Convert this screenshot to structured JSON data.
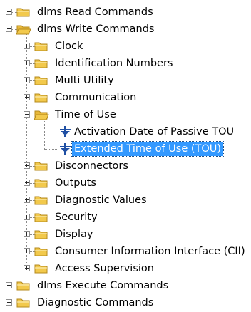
{
  "tree": {
    "items": [
      {
        "label": "dlms Read Commands",
        "level": 0,
        "expander": "plus",
        "icon": "folder-icon",
        "selected": false
      },
      {
        "label": "dlms Write Commands",
        "level": 0,
        "expander": "minus",
        "icon": "folder-open-icon",
        "selected": false
      },
      {
        "label": "Clock",
        "level": 1,
        "expander": "plus",
        "icon": "folder-icon",
        "selected": false
      },
      {
        "label": "Identification Numbers",
        "level": 1,
        "expander": "plus",
        "icon": "folder-icon",
        "selected": false
      },
      {
        "label": "Multi Utility",
        "level": 1,
        "expander": "plus",
        "icon": "folder-icon",
        "selected": false
      },
      {
        "label": "Communication",
        "level": 1,
        "expander": "plus",
        "icon": "folder-icon",
        "selected": false
      },
      {
        "label": "Time of Use",
        "level": 1,
        "expander": "minus",
        "icon": "folder-open-icon",
        "selected": false
      },
      {
        "label": "Activation Date of Passive TOU",
        "level": 2,
        "expander": "none",
        "icon": "write-command-icon",
        "selected": false
      },
      {
        "label": "Extended Time of Use (TOU)",
        "level": 2,
        "expander": "none",
        "icon": "write-command-icon",
        "selected": true
      },
      {
        "label": "Disconnectors",
        "level": 1,
        "expander": "plus",
        "icon": "folder-icon",
        "selected": false
      },
      {
        "label": "Outputs",
        "level": 1,
        "expander": "plus",
        "icon": "folder-icon",
        "selected": false
      },
      {
        "label": "Diagnostic Values",
        "level": 1,
        "expander": "plus",
        "icon": "folder-icon",
        "selected": false
      },
      {
        "label": "Security",
        "level": 1,
        "expander": "plus",
        "icon": "folder-icon",
        "selected": false
      },
      {
        "label": "Display",
        "level": 1,
        "expander": "plus",
        "icon": "folder-icon",
        "selected": false
      },
      {
        "label": "Consumer Information Interface (CII)",
        "level": 1,
        "expander": "plus",
        "icon": "folder-icon",
        "selected": false
      },
      {
        "label": "Access Supervision",
        "level": 1,
        "expander": "plus",
        "icon": "folder-icon",
        "selected": false
      },
      {
        "label": "dlms Execute Commands",
        "level": 0,
        "expander": "plus",
        "icon": "folder-icon",
        "selected": false
      },
      {
        "label": "Diagnostic Commands",
        "level": 0,
        "expander": "plus",
        "icon": "folder-icon",
        "selected": false
      }
    ]
  },
  "colors": {
    "selection": "#3399ff",
    "folder": "#f2c94c",
    "command_icon": "#1f4fa3"
  }
}
